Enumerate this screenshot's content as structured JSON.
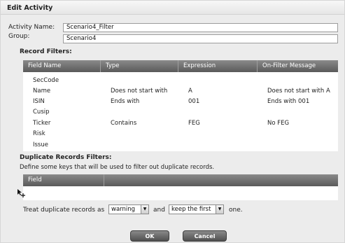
{
  "dialog": {
    "title": "Edit Activity"
  },
  "form": {
    "activity_name_label": "Activity Name:",
    "activity_name_value": "Scenario4_Filter",
    "group_label": "Group:",
    "group_value": "Scenario4"
  },
  "record_filters": {
    "title": "Record Filters:",
    "columns": [
      "Field Name",
      "Type",
      "Expression",
      "On-Filter Message"
    ],
    "rows": [
      {
        "field": "SecCode",
        "type": "",
        "expression": "",
        "message": ""
      },
      {
        "field": "Name",
        "type": "Does not start with",
        "expression": "A",
        "message": "Does not start with A"
      },
      {
        "field": "ISIN",
        "type": "Ends with",
        "expression": "001",
        "message": "Ends with 001"
      },
      {
        "field": "Cusip",
        "type": "",
        "expression": "",
        "message": ""
      },
      {
        "field": "Ticker",
        "type": "Contains",
        "expression": "FEG",
        "message": "No FEG"
      },
      {
        "field": "Risk",
        "type": "",
        "expression": "",
        "message": ""
      },
      {
        "field": "Issue",
        "type": "",
        "expression": "",
        "message": ""
      }
    ]
  },
  "duplicate_filters": {
    "title": "Duplicate Records Filters:",
    "description": "Define some keys that will be used to filter out duplicate records.",
    "columns": [
      "Field"
    ],
    "treat_prefix": "Treat duplicate records as",
    "treat_value": "warning",
    "and_text": "and",
    "keep_value": "keep the first",
    "suffix": "one."
  },
  "buttons": {
    "ok": "OK",
    "cancel": "Cancel"
  },
  "icons": {
    "dropdown_arrow": "▼",
    "add_cursor": "arrow-with-plus-icon"
  }
}
